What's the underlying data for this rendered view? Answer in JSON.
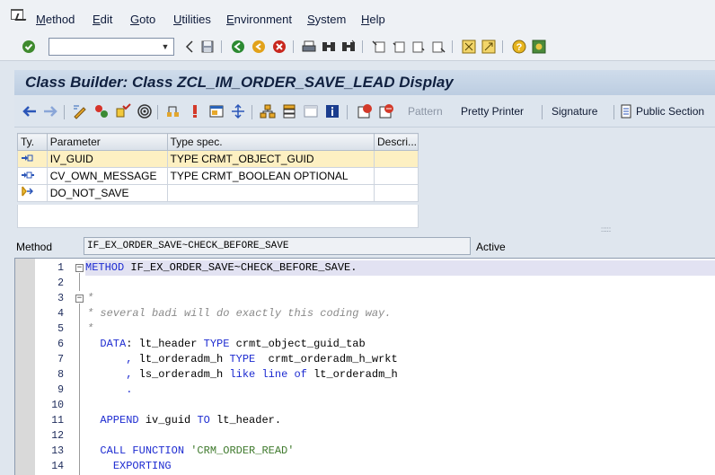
{
  "menu": {
    "items": [
      {
        "label": "Method",
        "u": "M",
        "rest": "ethod"
      },
      {
        "label": "Edit",
        "u": "E",
        "rest": "dit"
      },
      {
        "label": "Goto",
        "u": "G",
        "rest": "oto"
      },
      {
        "label": "Utilities",
        "u": "U",
        "rest": "tilities"
      },
      {
        "label": "Environment",
        "u": "E",
        "rest": "nvironment"
      },
      {
        "label": "System",
        "u": "S",
        "rest": "ystem"
      },
      {
        "label": "Help",
        "u": "H",
        "rest": "elp"
      }
    ]
  },
  "command_field": {
    "value": ""
  },
  "title": "Class Builder: Class ZCL_IM_ORDER_SAVE_LEAD Display",
  "app_toolbar": {
    "pattern_label": "Pattern",
    "pretty_printer_label": "Pretty Printer",
    "signature_label": "Signature",
    "public_section_label": "Public Section"
  },
  "param_table": {
    "headers": {
      "ty": "Ty.",
      "parameter": "Parameter",
      "type_spec": "Type spec.",
      "descr": "Descri..."
    },
    "rows": [
      {
        "ty_icon": "importing-icon",
        "parameter": "IV_GUID",
        "type_spec": "TYPE CRMT_OBJECT_GUID",
        "descr": ""
      },
      {
        "ty_icon": "changing-icon",
        "parameter": "CV_OWN_MESSAGE",
        "type_spec": "TYPE CRMT_BOOLEAN OPTIONAL",
        "descr": ""
      },
      {
        "ty_icon": "exception-icon",
        "parameter": "DO_NOT_SAVE",
        "type_spec": "",
        "descr": ""
      }
    ]
  },
  "method_row": {
    "label": "Method",
    "value": "IF_EX_ORDER_SAVE~CHECK_BEFORE_SAVE",
    "status": "Active"
  },
  "editor": {
    "line_numbers": [
      "1",
      "2",
      "3",
      "4",
      "5",
      "6",
      "7",
      "8",
      "9",
      "10",
      "11",
      "12",
      "13",
      "14"
    ]
  },
  "colors": {
    "title_bg": "#c4d3e6",
    "keyword": "#1d2bd1",
    "comment": "#8a8a8a",
    "string": "#3f7a2d",
    "selected_row": "#fdf0c2"
  }
}
